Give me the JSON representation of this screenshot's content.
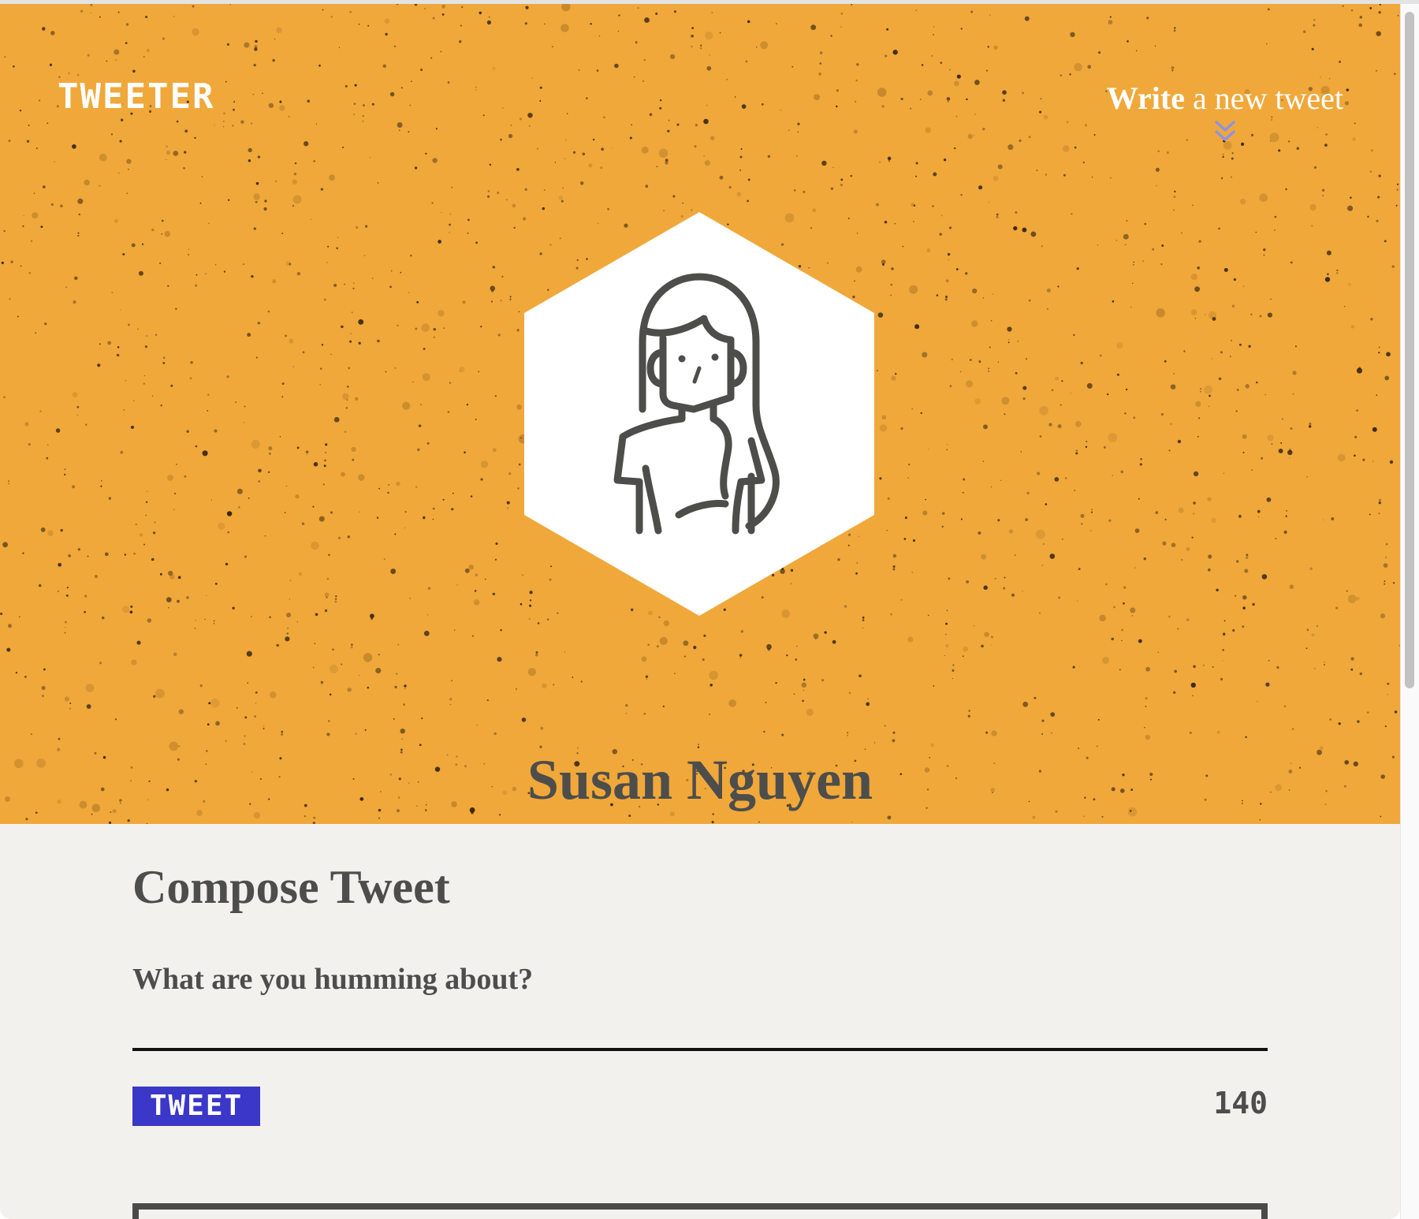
{
  "nav": {
    "brand": "TWEETER",
    "write_strong": "Write",
    "write_rest": " a new tweet",
    "toggle_icon": "double-chevron-down-icon"
  },
  "profile": {
    "name": "Susan Nguyen",
    "avatar_icon": "woman-avatar-icon"
  },
  "compose": {
    "title": "Compose Tweet",
    "prompt": "What are you humming about?",
    "input_value": "",
    "button_label": "TWEET",
    "counter": "140"
  },
  "colors": {
    "hero_background": "#f0a83b",
    "text_dark": "#4d4d4b",
    "page_background": "#f2f1ed",
    "button_background": "#3b37c8",
    "chevron": "#8c92e6"
  }
}
